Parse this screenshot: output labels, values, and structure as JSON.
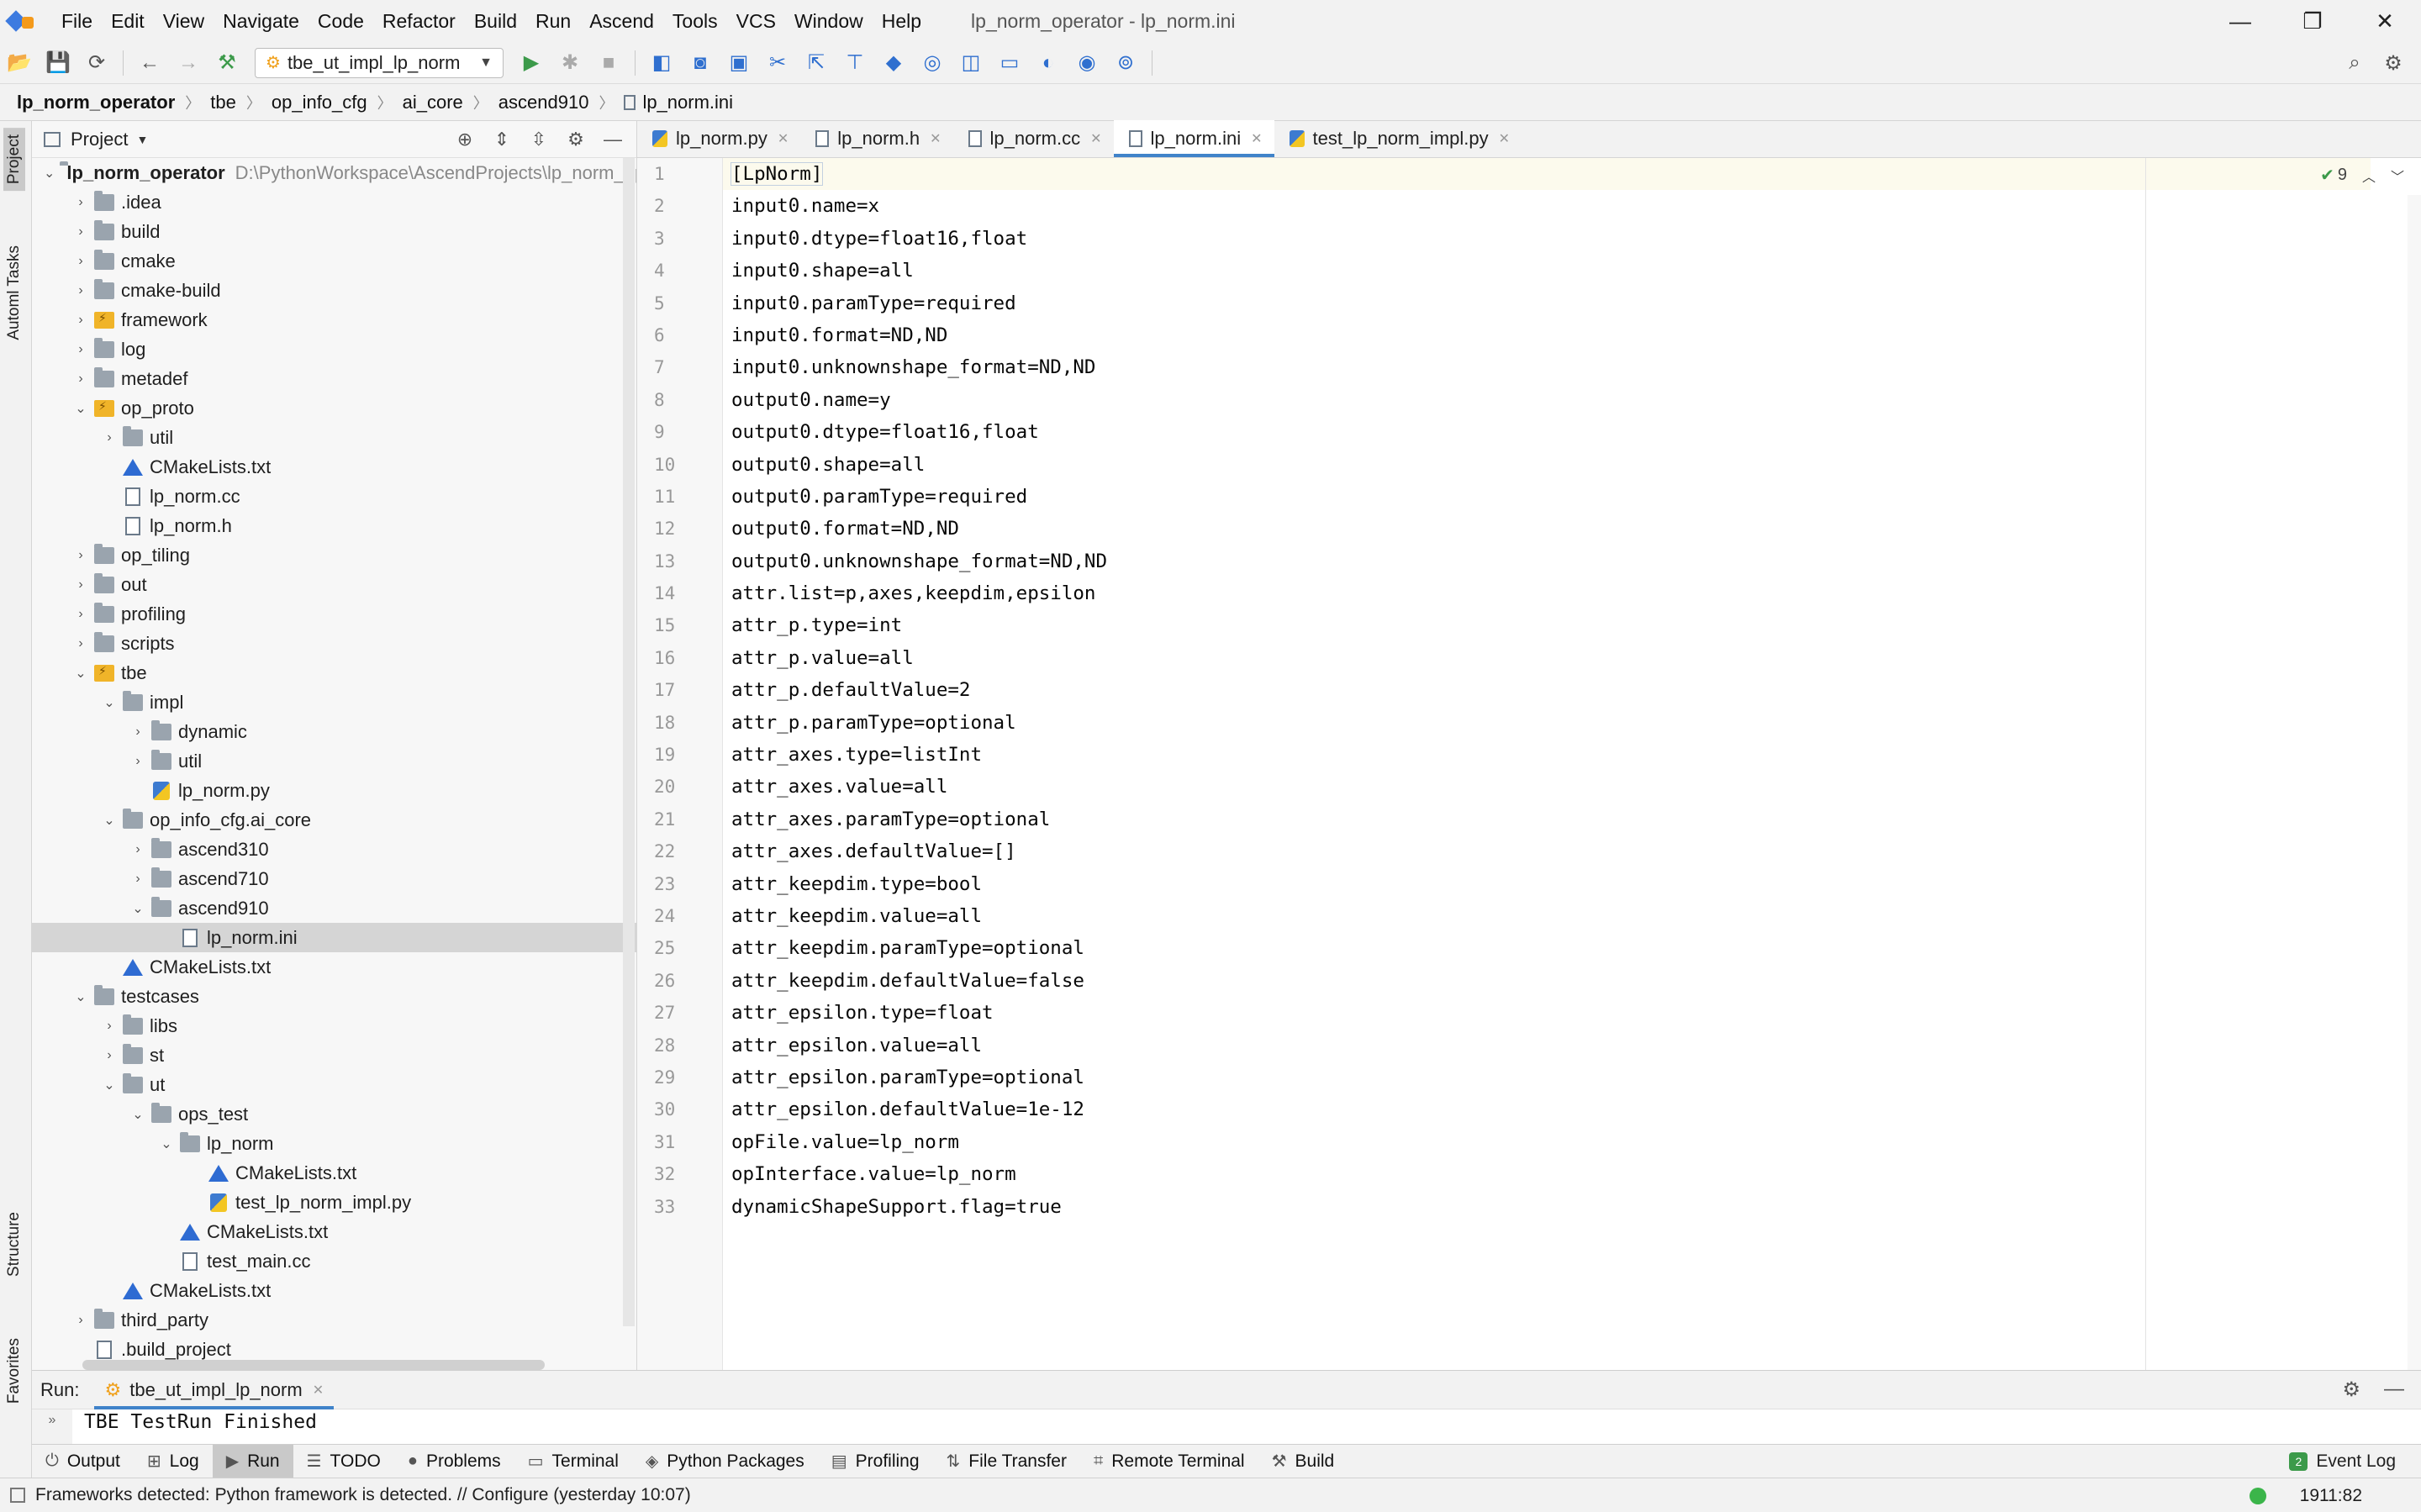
{
  "menubar": {
    "items": [
      "File",
      "Edit",
      "View",
      "Navigate",
      "Code",
      "Refactor",
      "Build",
      "Run",
      "Ascend",
      "Tools",
      "VCS",
      "Window",
      "Help"
    ],
    "window_title": "lp_norm_operator - lp_norm.ini",
    "controls": {
      "minimize": "—",
      "restore": "❐",
      "close": "✕"
    }
  },
  "toolbar": {
    "run_config": "tbe_ut_impl_lp_norm"
  },
  "breadcrumb": [
    "lp_norm_operator",
    "tbe",
    "op_info_cfg",
    "ai_core",
    "ascend910",
    "lp_norm.ini"
  ],
  "left_stripe": {
    "project": "Project",
    "tasks": "Automl Tasks",
    "structure": "Structure",
    "favorites": "Favorites"
  },
  "project_panel": {
    "title": "Project",
    "root_name": "lp_norm_operator",
    "root_path": "D:\\PythonWorkspace\\AscendProjects\\lp_norm_operator",
    "items": [
      {
        "label": ".idea",
        "depth": 1,
        "type": "folder",
        "chev": "›"
      },
      {
        "label": "build",
        "depth": 1,
        "type": "folder",
        "chev": "›"
      },
      {
        "label": "cmake",
        "depth": 1,
        "type": "folder",
        "chev": "›"
      },
      {
        "label": "cmake-build",
        "depth": 1,
        "type": "folder",
        "chev": "›"
      },
      {
        "label": "framework",
        "depth": 1,
        "type": "folder-special",
        "chev": "›"
      },
      {
        "label": "log",
        "depth": 1,
        "type": "folder",
        "chev": "›"
      },
      {
        "label": "metadef",
        "depth": 1,
        "type": "folder",
        "chev": "›"
      },
      {
        "label": "op_proto",
        "depth": 1,
        "type": "folder-special",
        "chev": "⌄"
      },
      {
        "label": "util",
        "depth": 2,
        "type": "folder",
        "chev": "›"
      },
      {
        "label": "CMakeLists.txt",
        "depth": 2,
        "type": "cmake",
        "chev": ""
      },
      {
        "label": "lp_norm.cc",
        "depth": 2,
        "type": "file",
        "chev": ""
      },
      {
        "label": "lp_norm.h",
        "depth": 2,
        "type": "file",
        "chev": ""
      },
      {
        "label": "op_tiling",
        "depth": 1,
        "type": "folder",
        "chev": "›"
      },
      {
        "label": "out",
        "depth": 1,
        "type": "folder",
        "chev": "›"
      },
      {
        "label": "profiling",
        "depth": 1,
        "type": "folder",
        "chev": "›"
      },
      {
        "label": "scripts",
        "depth": 1,
        "type": "folder",
        "chev": "›"
      },
      {
        "label": "tbe",
        "depth": 1,
        "type": "folder-special",
        "chev": "⌄"
      },
      {
        "label": "impl",
        "depth": 2,
        "type": "folder",
        "chev": "⌄"
      },
      {
        "label": "dynamic",
        "depth": 3,
        "type": "folder",
        "chev": "›"
      },
      {
        "label": "util",
        "depth": 3,
        "type": "folder",
        "chev": "›"
      },
      {
        "label": "lp_norm.py",
        "depth": 3,
        "type": "py",
        "chev": ""
      },
      {
        "label": "op_info_cfg.ai_core",
        "depth": 2,
        "type": "folder",
        "chev": "⌄"
      },
      {
        "label": "ascend310",
        "depth": 3,
        "type": "folder",
        "chev": "›"
      },
      {
        "label": "ascend710",
        "depth": 3,
        "type": "folder",
        "chev": "›"
      },
      {
        "label": "ascend910",
        "depth": 3,
        "type": "folder",
        "chev": "⌄"
      },
      {
        "label": "lp_norm.ini",
        "depth": 4,
        "type": "file",
        "chev": "",
        "selected": true
      },
      {
        "label": "CMakeLists.txt",
        "depth": 2,
        "type": "cmake",
        "chev": ""
      },
      {
        "label": "testcases",
        "depth": 1,
        "type": "folder",
        "chev": "⌄"
      },
      {
        "label": "libs",
        "depth": 2,
        "type": "folder",
        "chev": "›"
      },
      {
        "label": "st",
        "depth": 2,
        "type": "folder",
        "chev": "›"
      },
      {
        "label": "ut",
        "depth": 2,
        "type": "folder",
        "chev": "⌄"
      },
      {
        "label": "ops_test",
        "depth": 3,
        "type": "folder",
        "chev": "⌄"
      },
      {
        "label": "lp_norm",
        "depth": 4,
        "type": "folder",
        "chev": "⌄"
      },
      {
        "label": "CMakeLists.txt",
        "depth": 5,
        "type": "cmake",
        "chev": ""
      },
      {
        "label": "test_lp_norm_impl.py",
        "depth": 5,
        "type": "py",
        "chev": ""
      },
      {
        "label": "CMakeLists.txt",
        "depth": 4,
        "type": "cmake",
        "chev": ""
      },
      {
        "label": "test_main.cc",
        "depth": 4,
        "type": "file",
        "chev": ""
      },
      {
        "label": "CMakeLists.txt",
        "depth": 2,
        "type": "cmake",
        "chev": ""
      },
      {
        "label": "third_party",
        "depth": 1,
        "type": "folder",
        "chev": "›"
      },
      {
        "label": ".build_project",
        "depth": 1,
        "type": "file",
        "chev": ""
      }
    ]
  },
  "editor": {
    "tabs": [
      {
        "label": "lp_norm.py",
        "icon": "py",
        "active": false
      },
      {
        "label": "lp_norm.h",
        "icon": "file",
        "active": false
      },
      {
        "label": "lp_norm.cc",
        "icon": "file",
        "active": false
      },
      {
        "label": "lp_norm.ini",
        "icon": "file",
        "active": true
      },
      {
        "label": "test_lp_norm_impl.py",
        "icon": "py",
        "active": false
      }
    ],
    "inspection_count": "9",
    "lines": [
      "[LpNorm]",
      "input0.name=x",
      "input0.dtype=float16,float",
      "input0.shape=all",
      "input0.paramType=required",
      "input0.format=ND,ND",
      "input0.unknownshape_format=ND,ND",
      "output0.name=y",
      "output0.dtype=float16,float",
      "output0.shape=all",
      "output0.paramType=required",
      "output0.format=ND,ND",
      "output0.unknownshape_format=ND,ND",
      "attr.list=p,axes,keepdim,epsilon",
      "attr_p.type=int",
      "attr_p.value=all",
      "attr_p.defaultValue=2",
      "attr_p.paramType=optional",
      "attr_axes.type=listInt",
      "attr_axes.value=all",
      "attr_axes.paramType=optional",
      "attr_axes.defaultValue=[]",
      "attr_keepdim.type=bool",
      "attr_keepdim.value=all",
      "attr_keepdim.paramType=optional",
      "attr_keepdim.defaultValue=false",
      "attr_epsilon.type=float",
      "attr_epsilon.value=all",
      "attr_epsilon.paramType=optional",
      "attr_epsilon.defaultValue=1e-12",
      "opFile.value=lp_norm",
      "opInterface.value=lp_norm",
      "dynamicShapeSupport.flag=true"
    ]
  },
  "run_panel": {
    "label": "Run:",
    "tab": "tbe_ut_impl_lp_norm",
    "output": "TBE TestRun Finished"
  },
  "bottom_tools": [
    {
      "label": "Output",
      "icon": "⏻",
      "active": false
    },
    {
      "label": "Log",
      "icon": "⊞",
      "active": false
    },
    {
      "label": "Run",
      "icon": "▶",
      "active": true
    },
    {
      "label": "TODO",
      "icon": "☰",
      "active": false
    },
    {
      "label": "Problems",
      "icon": "●",
      "active": false
    },
    {
      "label": "Terminal",
      "icon": "▭",
      "active": false
    },
    {
      "label": "Python Packages",
      "icon": "◈",
      "active": false
    },
    {
      "label": "Profiling",
      "icon": "▤",
      "active": false
    },
    {
      "label": "File Transfer",
      "icon": "⇅",
      "active": false
    },
    {
      "label": "Remote Terminal",
      "icon": "⌗",
      "active": false
    },
    {
      "label": "Build",
      "icon": "⚒",
      "active": false
    }
  ],
  "event_log": "Event Log",
  "statusbar": {
    "message": "Frameworks detected: Python framework is detected. // Configure (yesterday 10:07)",
    "position": "1911:82"
  }
}
